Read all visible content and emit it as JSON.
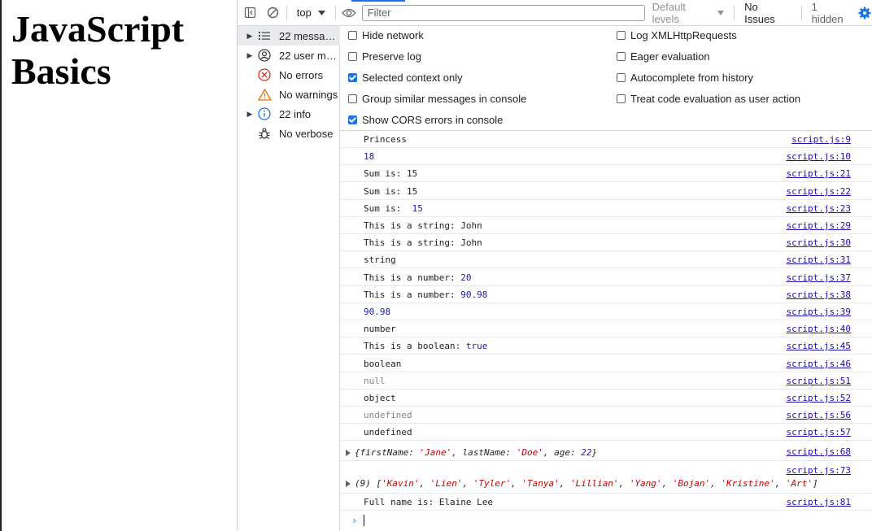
{
  "page": {
    "heading": "JavaScript Basics"
  },
  "toolbar": {
    "context": "top",
    "filter_placeholder": "Filter",
    "levels": "Default levels",
    "issues": "No Issues",
    "hidden": "1 hidden"
  },
  "sidebar": {
    "items": [
      {
        "label": "22 messages",
        "expandable": true,
        "selected": true,
        "icon": "list-icon"
      },
      {
        "label": "22 user messages",
        "expandable": true,
        "selected": false,
        "icon": "user-icon"
      },
      {
        "label": "No errors",
        "expandable": false,
        "selected": false,
        "icon": "error-icon"
      },
      {
        "label": "No warnings",
        "expandable": false,
        "selected": false,
        "icon": "warning-icon"
      },
      {
        "label": "22 info",
        "expandable": true,
        "selected": false,
        "icon": "info-icon"
      },
      {
        "label": "No verbose",
        "expandable": false,
        "selected": false,
        "icon": "bug-icon"
      }
    ]
  },
  "settings": {
    "left": [
      {
        "label": "Hide network",
        "checked": false
      },
      {
        "label": "Preserve log",
        "checked": false
      },
      {
        "label": "Selected context only",
        "checked": true
      },
      {
        "label": "Group similar messages in console",
        "checked": false
      },
      {
        "label": "Show CORS errors in console",
        "checked": true
      }
    ],
    "right": [
      {
        "label": "Log XMLHttpRequests",
        "checked": false
      },
      {
        "label": "Eager evaluation",
        "checked": false
      },
      {
        "label": "Autocomplete from history",
        "checked": false
      },
      {
        "label": "Treat code evaluation as user action",
        "checked": false
      }
    ]
  },
  "console": {
    "messages": [
      {
        "text": "Princess",
        "source": "script.js:9"
      },
      {
        "text": "18",
        "source": "script.js:10",
        "style": "number"
      },
      {
        "text": "Sum is: 15",
        "source": "script.js:21"
      },
      {
        "text": "Sum is: 15",
        "source": "script.js:22"
      },
      {
        "text": "Sum is:  ",
        "value": "15",
        "source": "script.js:23"
      },
      {
        "text": "This is a string: John",
        "source": "script.js:29"
      },
      {
        "text": "This is a string: John",
        "source": "script.js:30"
      },
      {
        "text": "string",
        "source": "script.js:31"
      },
      {
        "text": "This is a number: ",
        "value": "20",
        "source": "script.js:37"
      },
      {
        "text": "This is a number: ",
        "value": "90.98",
        "source": "script.js:38"
      },
      {
        "text": "90.98",
        "source": "script.js:39",
        "style": "number"
      },
      {
        "text": "number",
        "source": "script.js:40"
      },
      {
        "text": "This is a boolean: ",
        "value": "true",
        "source": "script.js:45"
      },
      {
        "text": "boolean",
        "source": "script.js:46"
      },
      {
        "text": "null",
        "source": "script.js:51",
        "style": "muted"
      },
      {
        "text": "object",
        "source": "script.js:52"
      },
      {
        "text": "undefined",
        "source": "script.js:56",
        "style": "muted"
      },
      {
        "text": "undefined",
        "source": "script.js:57"
      }
    ],
    "object_log": {
      "source": "script.js:68",
      "text": "{firstName: 'Jane', lastName: 'Doe', age: 22}"
    },
    "array_log": {
      "source": "script.js:73",
      "count": "(9)",
      "items": [
        "Kavin",
        "Lien",
        "Tyler",
        "Tanya",
        "Lillian",
        "Yang",
        "Bojan",
        "Kristine",
        "Art"
      ]
    },
    "last": {
      "text": "Full name is: Elaine Lee",
      "source": "script.js:81"
    }
  }
}
